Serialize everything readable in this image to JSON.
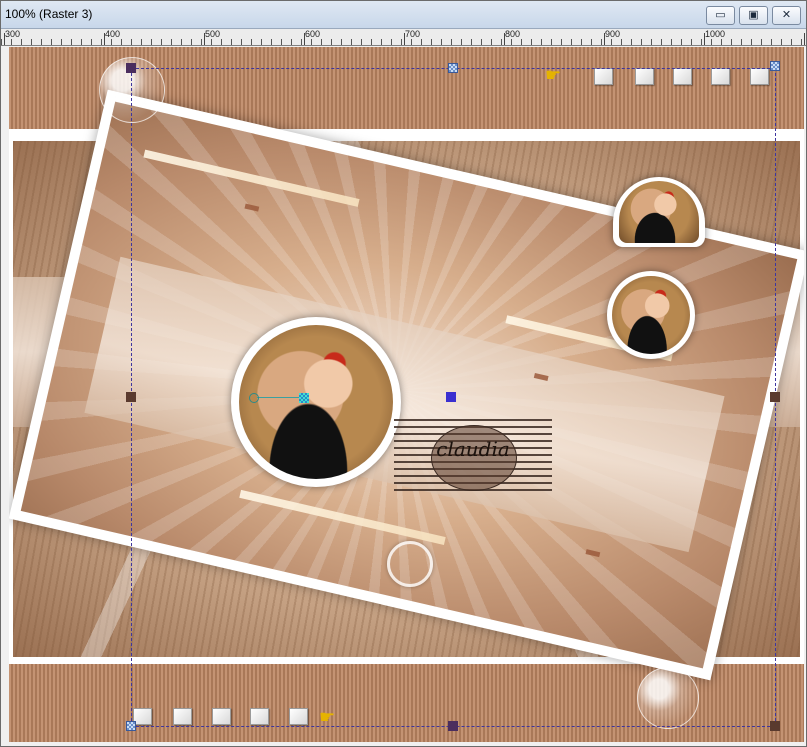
{
  "window": {
    "title": "100% (Raster 3)",
    "minimize_glyph": "▭",
    "maximize_glyph": "▣",
    "close_glyph": "✕"
  },
  "ruler": {
    "labels": [
      "300",
      "400",
      "500",
      "600",
      "700",
      "800",
      "900",
      "1000"
    ]
  },
  "watermark": {
    "name": "claudia"
  },
  "icons": {
    "hand": "pointing-hand-icon",
    "square": "square-button-icon"
  },
  "colors": {
    "selection": "#3d35a0",
    "handle_blue": "#3a2fd0",
    "canvas_tan": "#bf9070"
  }
}
